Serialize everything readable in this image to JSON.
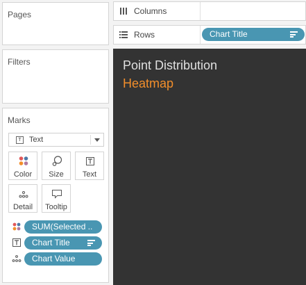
{
  "cards": {
    "pages": "Pages",
    "filters": "Filters",
    "marks": "Marks"
  },
  "marks": {
    "mark_type": "Text",
    "buttons": {
      "color": "Color",
      "size": "Size",
      "text": "Text",
      "detail": "Detail",
      "tooltip": "Tooltip"
    },
    "pills": [
      {
        "label": "SUM(Selected ..",
        "role": "color"
      },
      {
        "label": "Chart Title",
        "role": "text",
        "sorted": true
      },
      {
        "label": "Chart Value",
        "role": "detail"
      }
    ]
  },
  "shelves": {
    "columns": "Columns",
    "rows": "Rows",
    "rows_pill": "Chart Title"
  },
  "viz": {
    "title": "Point Distribution",
    "subtitle": "Heatmap"
  },
  "colors": {
    "pill": "#4996b2",
    "viz_background": "#333333",
    "subtitle": "#f28e2b"
  }
}
